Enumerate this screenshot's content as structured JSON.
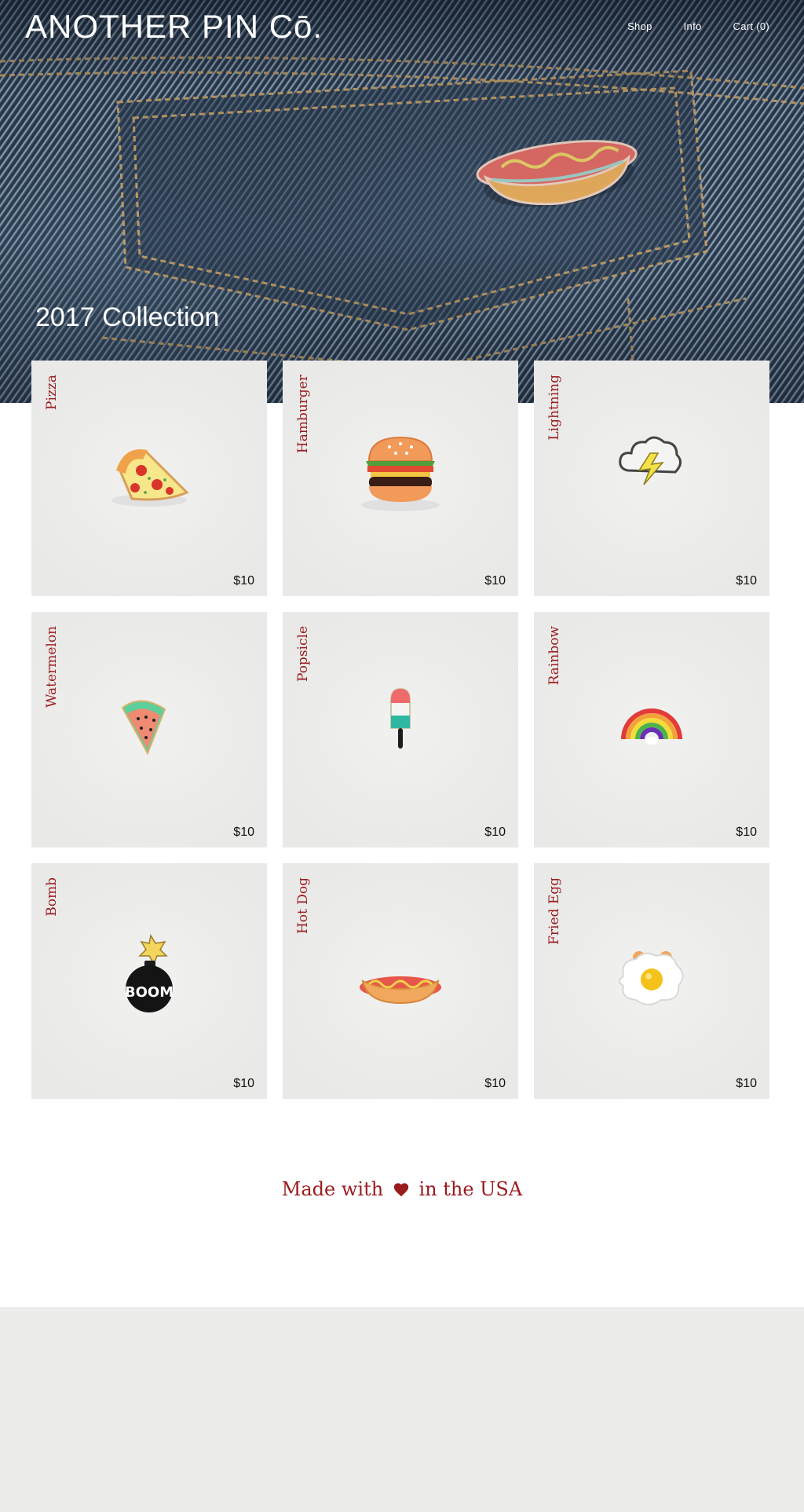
{
  "header": {
    "logo": "ANOTHER PIN Cō.",
    "nav": [
      "Shop",
      "Info",
      "Cart (0)"
    ]
  },
  "hero": {
    "title": "2017 Collection",
    "pin_icon": "hot-dog-pin"
  },
  "products": [
    {
      "name": "Pizza",
      "price": "$10",
      "icon": "pizza-pin"
    },
    {
      "name": "Hamburger",
      "price": "$10",
      "icon": "hamburger-pin"
    },
    {
      "name": "Lightning",
      "price": "$10",
      "icon": "lightning-cloud-pin"
    },
    {
      "name": "Watermelon",
      "price": "$10",
      "icon": "watermelon-pin"
    },
    {
      "name": "Popsicle",
      "price": "$10",
      "icon": "popsicle-pin"
    },
    {
      "name": "Rainbow",
      "price": "$10",
      "icon": "rainbow-pin"
    },
    {
      "name": "Bomb",
      "price": "$10",
      "icon": "bomb-pin"
    },
    {
      "name": "Hot Dog",
      "price": "$10",
      "icon": "hot-dog-pin"
    },
    {
      "name": "Fried Egg",
      "price": "$10",
      "icon": "fried-egg-pin"
    }
  ],
  "footer": {
    "made_prefix": "Made with",
    "made_suffix": "in the USA",
    "heart_icon": "heart-icon"
  },
  "colors": {
    "accent": "#9a1b1e",
    "card_bg": "#ebebe9",
    "footer_bg": "#ececea"
  }
}
